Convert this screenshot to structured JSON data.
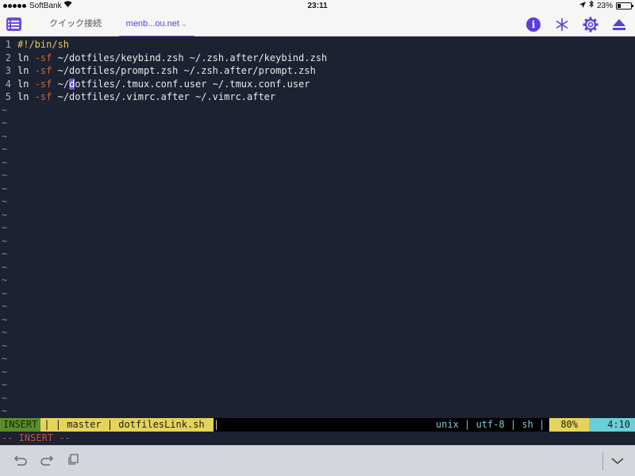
{
  "status_bar": {
    "carrier": "SoftBank",
    "time": "23:11",
    "battery_text": "23%",
    "battery_level": 0.23
  },
  "tabs": {
    "quick_connect": "クイック接続",
    "active_host": "menb...ou.net"
  },
  "icons": {
    "menu": "list-menu-icon",
    "info": "info-circle-icon",
    "sparkle": "asterisk-icon",
    "settings": "gear-icon",
    "eject": "eject-icon",
    "undo": "undo-icon",
    "redo": "redo-icon",
    "paste": "paste-icon",
    "hide_keyboard": "chevron-down-icon"
  },
  "editor": {
    "lines": [
      {
        "num": "1",
        "shebang": "#!/bin/sh"
      },
      {
        "num": "2",
        "cmd": "ln ",
        "flag": "-sf",
        "rest": " ~/dotfiles/keybind.zsh ~/.zsh.after/keybind.zsh"
      },
      {
        "num": "3",
        "cmd": "ln ",
        "flag": "-sf",
        "rest": " ~/dotfiles/prompt.zsh ~/.zsh.after/prompt.zsh"
      },
      {
        "num": "4",
        "cmd": "ln ",
        "flag": "-sf",
        "pre_cursor": " ~/",
        "cursor": "d",
        "post_cursor": "otfiles/.tmux.conf.user ~/.tmux.conf.user"
      },
      {
        "num": "5",
        "cmd": "ln ",
        "flag": "-sf",
        "rest": " ~/dotfiles/.vimrc.after ~/.vimrc.after"
      }
    ],
    "empty_marker": "~",
    "empty_line_count": 24
  },
  "statusline": {
    "mode": "INSERT",
    "git": "| | master | dotfilesLink.sh ",
    "sep": "|",
    "info": "unix | utf-8 | sh |",
    "percent": "80%",
    "position": "4:10"
  },
  "cmdline": "-- INSERT --",
  "colors": {
    "background": "#1c2232",
    "accent": "#6a4fd8",
    "insert_mode": "#5e8c2a",
    "git_segment": "#e5d45c",
    "position_segment": "#6bcfd8",
    "cmdline_text": "#c0543a"
  }
}
